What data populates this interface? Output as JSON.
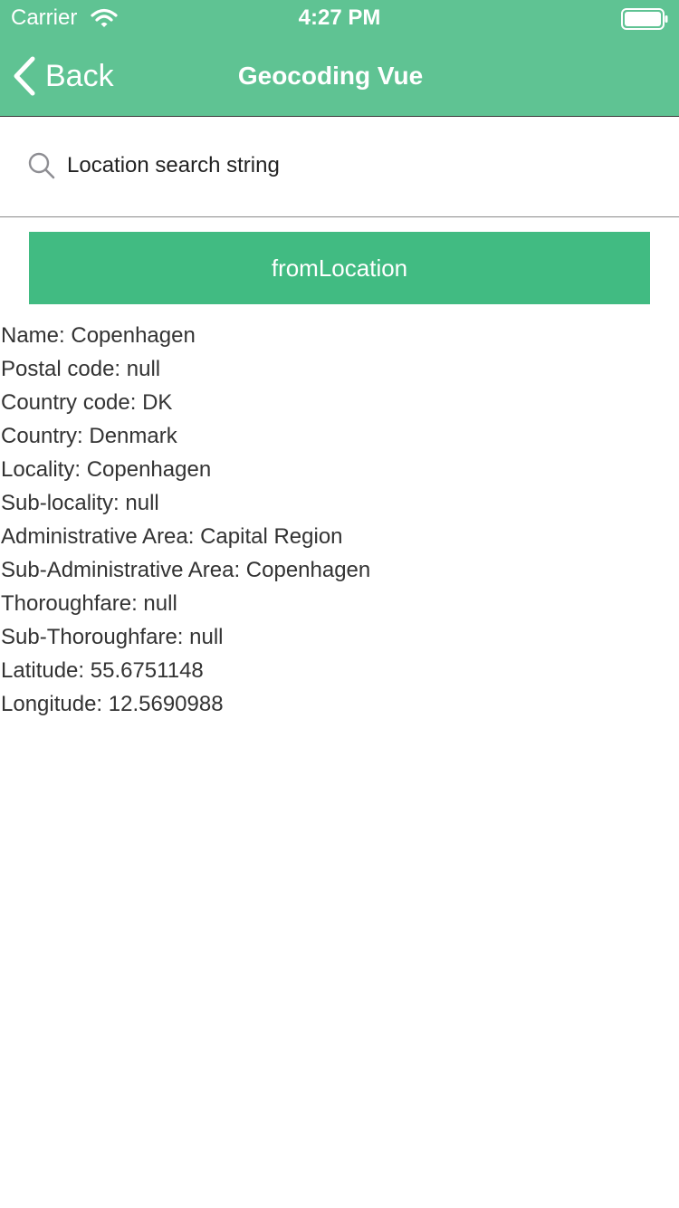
{
  "status_bar": {
    "carrier": "Carrier",
    "time": "4:27 PM",
    "icons": [
      "wifi-icon",
      "battery-icon"
    ]
  },
  "nav": {
    "back_label": "Back",
    "title": "Geocoding Vue",
    "back_icon": "chevron-left-icon"
  },
  "search": {
    "icon": "search-icon",
    "placeholder": "Location search string"
  },
  "action_button": {
    "label": "fromLocation"
  },
  "results": [
    "Name: Copenhagen",
    "Postal code: null",
    "Country code: DK",
    "Country: Denmark",
    "Locality: Copenhagen",
    "Sub-locality: null",
    "Administrative Area: Capital Region",
    "Sub-Administrative Area: Copenhagen",
    "Thoroughfare: null",
    "Sub-Thoroughfare: null",
    "Latitude: 55.6751148",
    "Longitude: 12.5690988"
  ],
  "colors": {
    "header_green": "#5fc393",
    "button_green": "#41bb82",
    "text": "#333333"
  }
}
